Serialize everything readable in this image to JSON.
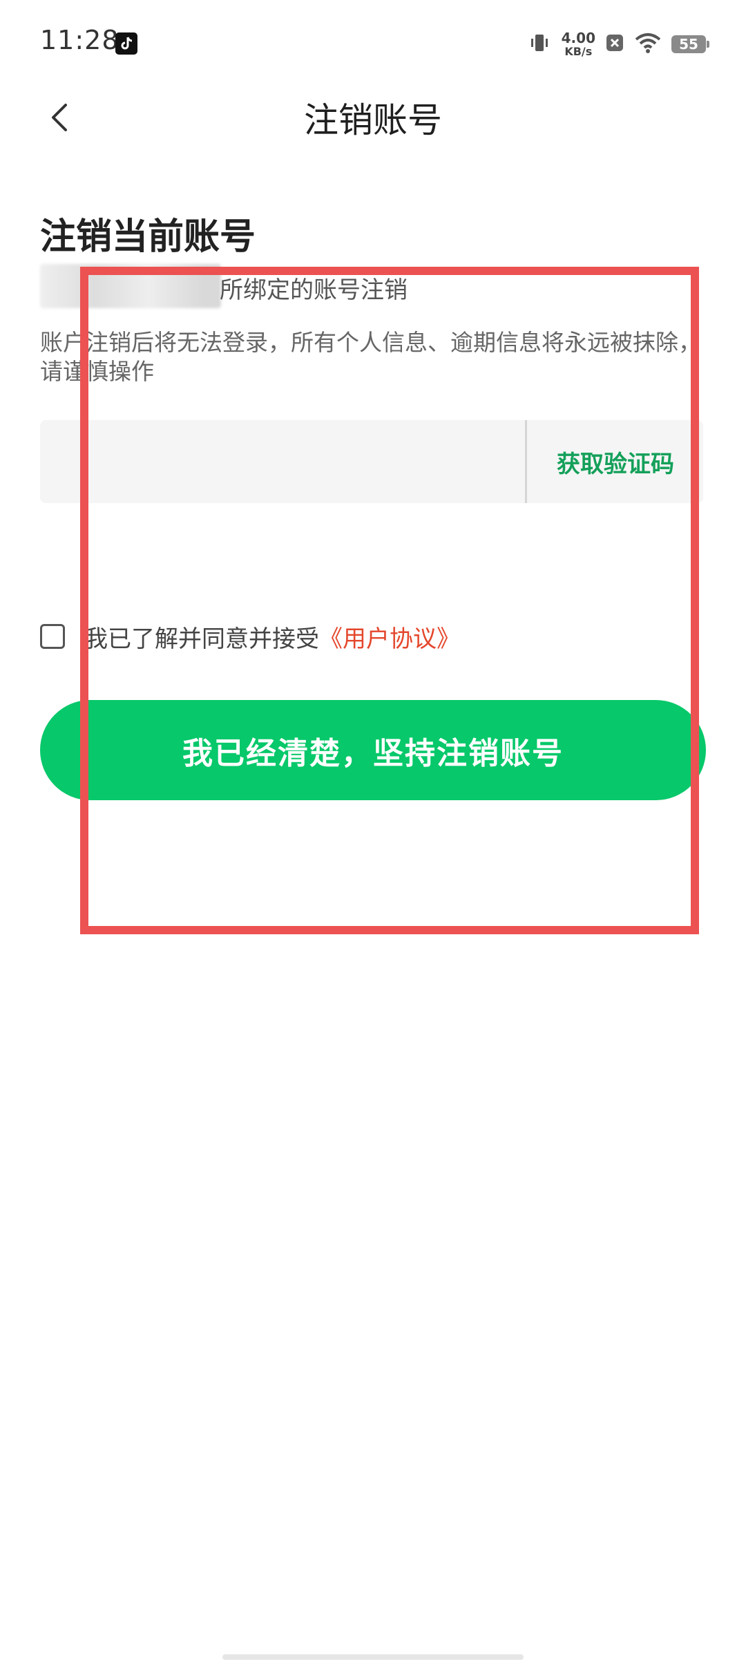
{
  "status_bar": {
    "time": "11:28",
    "network_speed_value": "4.00",
    "network_speed_unit": "KB/s",
    "battery": "55",
    "icons": [
      "tiktok-icon",
      "vibrate-icon",
      "x-badge-icon",
      "wifi-icon",
      "battery-icon"
    ]
  },
  "header": {
    "title": "注销账号",
    "back_icon": "chevron-left-icon"
  },
  "content": {
    "section_title": "注销当前账号",
    "bind_text": "所绑定的账号注销",
    "warning": "账户注销后将无法登录，所有个人信息、逾期信息将永远被抹除，请谨慎操作",
    "code_input_placeholder": "",
    "get_code_label": "获取验证码",
    "agree_text": "我已了解并同意并接受",
    "agree_link": "《用户协议》",
    "confirm_button": "我已经清楚，坚持注销账号"
  },
  "colors": {
    "accent_green": "#07c86a",
    "link_red": "#e4472c",
    "annotation_red": "#ec5252",
    "code_green": "#14a05a"
  }
}
